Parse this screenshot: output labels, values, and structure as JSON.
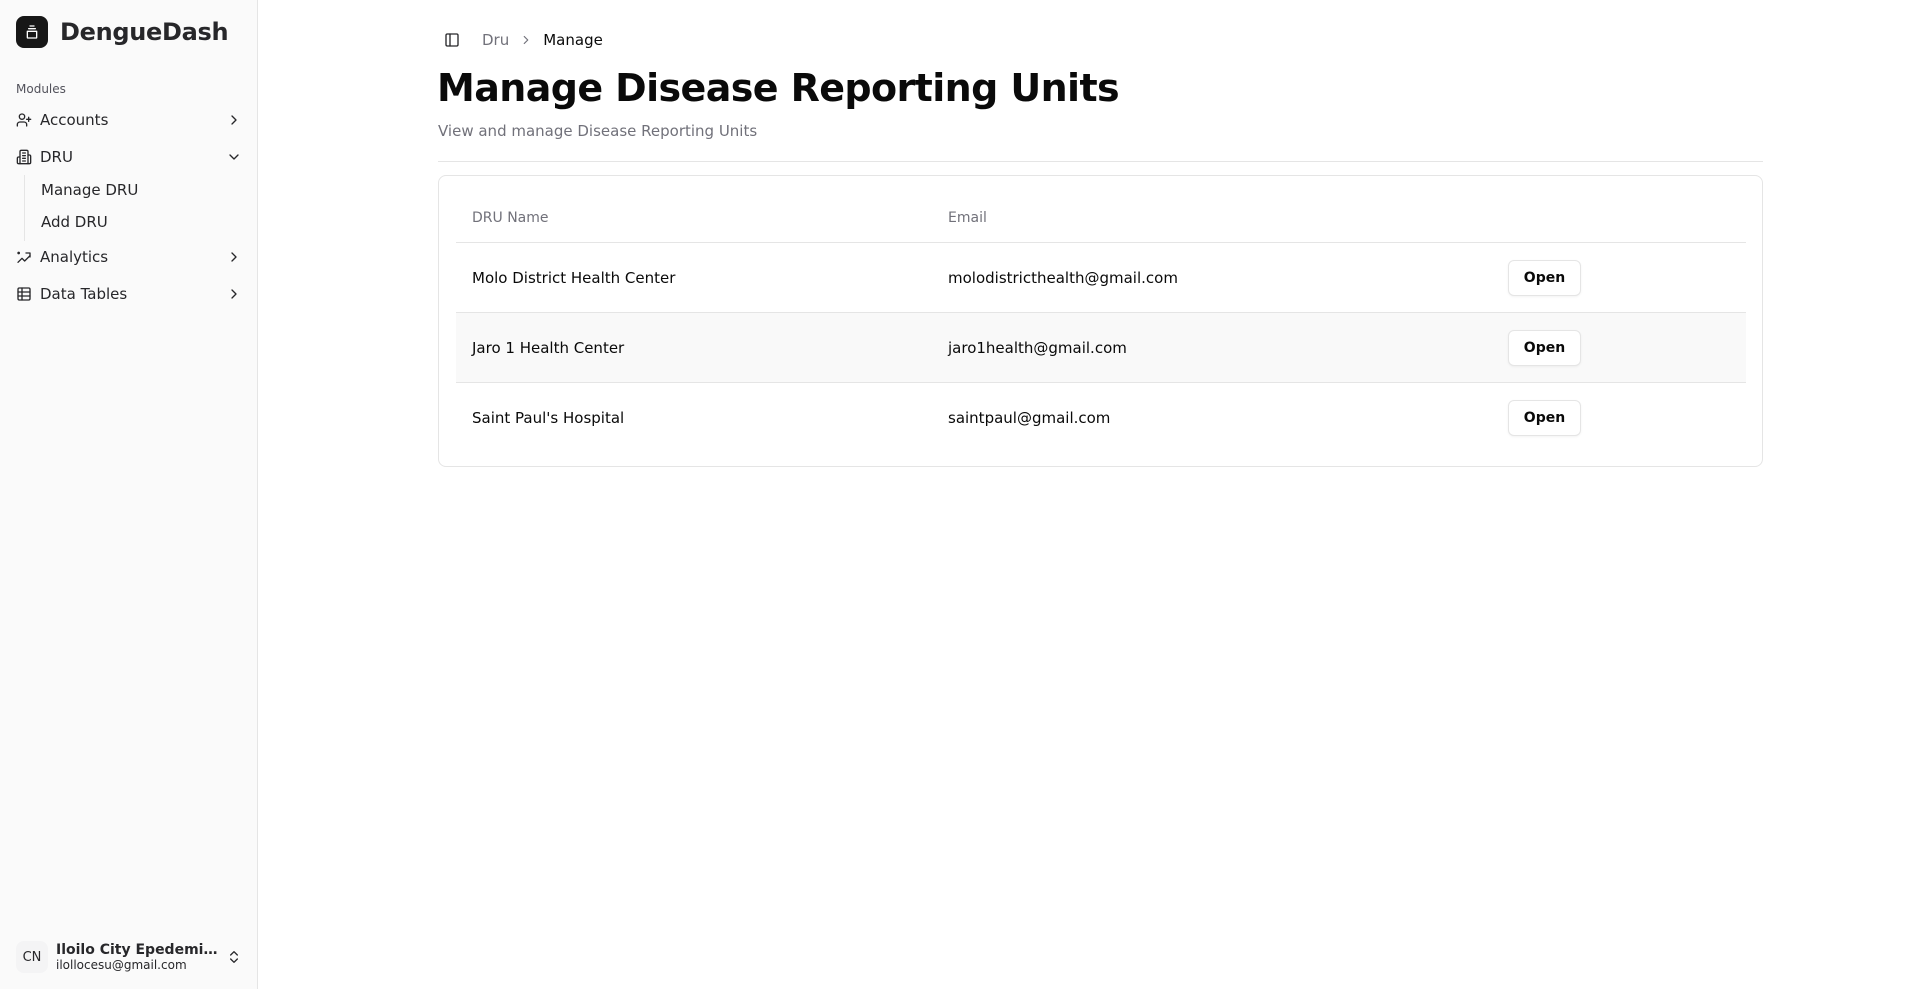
{
  "brand": {
    "name": "DengueDash",
    "logo_icon": "package-icon"
  },
  "sidebar": {
    "group_label": "Modules",
    "items": [
      {
        "label": "Accounts",
        "icon": "user-plus-icon",
        "chevron": "chevron-right"
      },
      {
        "label": "DRU",
        "icon": "building-icon",
        "chevron": "chevron-down",
        "sub_items": [
          {
            "label": "Manage DRU"
          },
          {
            "label": "Add DRU"
          }
        ]
      },
      {
        "label": "Analytics",
        "icon": "trending-icon",
        "chevron": "chevron-right"
      },
      {
        "label": "Data Tables",
        "icon": "table-icon",
        "chevron": "chevron-right"
      }
    ],
    "user": {
      "initials": "CN",
      "name": "Iloilo City Epedemiol...",
      "email": "ilollocesu@gmail.com"
    }
  },
  "breadcrumb": {
    "parent": "Dru",
    "current": "Manage"
  },
  "page": {
    "title": "Manage Disease Reporting Units",
    "subtitle": "View and manage Disease Reporting Units"
  },
  "table": {
    "headers": {
      "name": "DRU Name",
      "email": "Email"
    },
    "rows": [
      {
        "name": "Molo District Health Center",
        "email": "molodistricthealth@gmail.com",
        "action": "Open"
      },
      {
        "name": "Jaro 1 Health Center",
        "email": "jaro1health@gmail.com",
        "action": "Open"
      },
      {
        "name": "Saint Paul's Hospital",
        "email": "saintpaul@gmail.com",
        "action": "Open"
      }
    ]
  },
  "colors": {
    "accent": "#171717",
    "sidebar_bg": "#fafafa",
    "muted_text": "#71717a",
    "border": "#e5e5e5"
  }
}
